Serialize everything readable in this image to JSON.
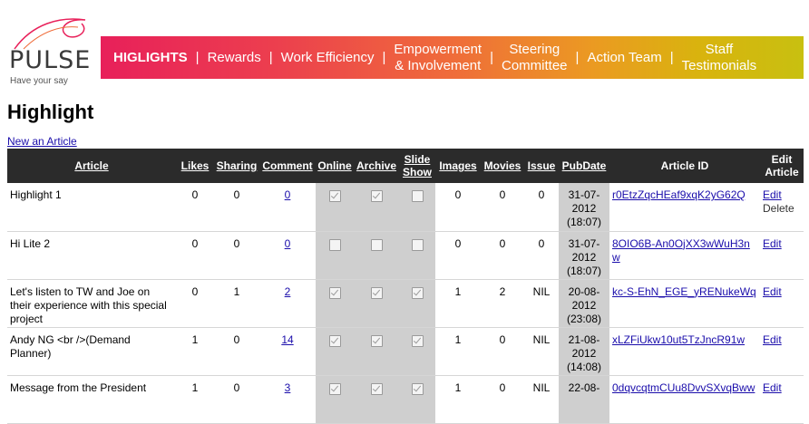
{
  "logo": {
    "word": "PULSE",
    "tagline": "Have your say"
  },
  "nav": [
    {
      "label": "HIGLIGHTS",
      "bold": true,
      "lines": [
        "HIGLIGHTS"
      ]
    },
    {
      "label": "Rewards",
      "lines": [
        "Rewards"
      ]
    },
    {
      "label": "Work Efficiency",
      "lines": [
        "Work Efficiency"
      ]
    },
    {
      "label": "Empowerment & Involvement",
      "lines": [
        "Empowerment",
        "& Involvement"
      ]
    },
    {
      "label": "Steering Committee",
      "lines": [
        "Steering",
        "Committee"
      ]
    },
    {
      "label": "Action Team",
      "lines": [
        "Action Team"
      ]
    },
    {
      "label": "Staff Testimonials",
      "lines": [
        "Staff",
        "Testimonials"
      ]
    }
  ],
  "nav_separator": "|",
  "page_title": "Highlight",
  "new_article_link": "New an Article",
  "table": {
    "headers": {
      "article": "Article",
      "likes": "Likes",
      "sharing": "Sharing",
      "comment": "Comment",
      "online": "Online",
      "archive": "Archive",
      "slide_show_1": "Slide",
      "slide_show_2": "Show",
      "images": "Images",
      "movies": "Movies",
      "issue": "Issue",
      "pubdate": "PubDate",
      "article_id": "Article ID",
      "edit_article_1": "Edit",
      "edit_article_2": "Article"
    },
    "rows": [
      {
        "article": "Highlight 1",
        "likes": "0",
        "sharing": "0",
        "comment": "0",
        "online": true,
        "archive": true,
        "slide": false,
        "images": "0",
        "movies": "0",
        "issue": "0",
        "pub_date": "31-07-",
        "pub_year": "2012",
        "pub_time": "(18:07)",
        "article_id": "r0EtzZqcHEaf9xqK2yG62Q",
        "edit": "Edit",
        "delete": "Delete"
      },
      {
        "article": "Hi Lite 2",
        "likes": "0",
        "sharing": "0",
        "comment": "0",
        "online": false,
        "archive": false,
        "slide": false,
        "images": "0",
        "movies": "0",
        "issue": "0",
        "pub_date": "31-07-",
        "pub_year": "2012",
        "pub_time": "(18:07)",
        "article_id": "8OIO6B-An0OjXX3wWuH3nw",
        "edit": "Edit",
        "delete": ""
      },
      {
        "article": "Let's listen to TW and Joe on their experience with this special project",
        "likes": "0",
        "sharing": "1",
        "comment": "2",
        "online": true,
        "archive": true,
        "slide": true,
        "images": "1",
        "movies": "2",
        "issue": "NIL",
        "pub_date": "20-08-",
        "pub_year": "2012",
        "pub_time": "(23:08)",
        "article_id": "kc-S-EhN_EGE_yRENukeWq",
        "edit": "Edit",
        "delete": ""
      },
      {
        "article": "Andy NG <br />(Demand Planner)",
        "likes": "1",
        "sharing": "0",
        "comment": "14",
        "online": true,
        "archive": true,
        "slide": true,
        "images": "1",
        "movies": "0",
        "issue": "NIL",
        "pub_date": "21-08-",
        "pub_year": "2012",
        "pub_time": "(14:08)",
        "article_id": "xLZFiUkw10ut5TzJncR91w",
        "edit": "Edit",
        "delete": ""
      },
      {
        "article": "Message from the President",
        "likes": "1",
        "sharing": "0",
        "comment": "3",
        "online": true,
        "archive": true,
        "slide": true,
        "images": "1",
        "movies": "0",
        "issue": "NIL",
        "pub_date": "22-08-",
        "pub_year": "",
        "pub_time": "",
        "article_id": "0dqvcqtmCUu8DvvSXvqBww",
        "edit": "Edit",
        "delete": ""
      }
    ]
  },
  "colors": {
    "nav_gradient_start": "#e8205a",
    "nav_gradient_end": "#c8c010",
    "header_bg": "#2b2b2b",
    "link": "#1a0dab",
    "grey_column": "#cfcfcf"
  }
}
